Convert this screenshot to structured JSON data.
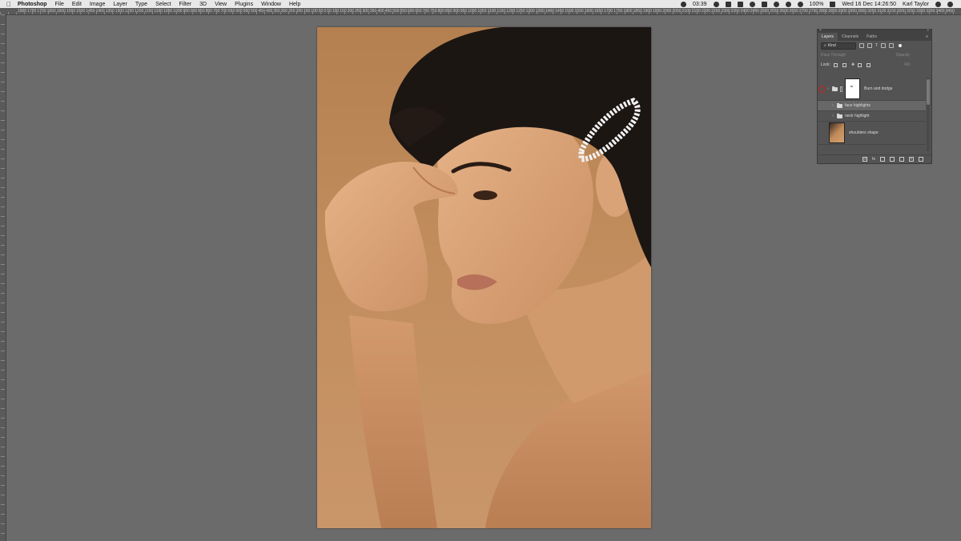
{
  "menubar": {
    "app_name": "Photoshop",
    "menus": [
      "File",
      "Edit",
      "Image",
      "Layer",
      "Type",
      "Select",
      "Filter",
      "3D",
      "View",
      "Plugins",
      "Window",
      "Help"
    ],
    "time_remaining": "03:39",
    "battery": "100%",
    "datetime": "Wed 16 Dec  14:26:50",
    "user": "Karl Taylor"
  },
  "ruler": {
    "ticks": [
      "1900",
      "1750",
      "1700",
      "1650",
      "1600",
      "1550",
      "1500",
      "1450",
      "1400",
      "1350",
      "1300",
      "1250",
      "1200",
      "1150",
      "1100",
      "1050",
      "1000",
      "950",
      "900",
      "850",
      "800",
      "750",
      "700",
      "650",
      "600",
      "550",
      "500",
      "450",
      "400",
      "350",
      "300",
      "250",
      "200",
      "150",
      "100",
      "50",
      "0",
      "50",
      "100",
      "150",
      "200",
      "250",
      "300",
      "350",
      "400",
      "450",
      "500",
      "550",
      "600",
      "650",
      "700",
      "750",
      "800",
      "850",
      "900",
      "950",
      "1000",
      "1050",
      "1100",
      "1150",
      "1200",
      "1250",
      "1300",
      "1350",
      "1400",
      "1450",
      "1500",
      "1550",
      "1600",
      "1650",
      "1700",
      "1750",
      "1800",
      "1850",
      "1900",
      "1950",
      "2000",
      "2050",
      "2100",
      "2150",
      "2200",
      "2250",
      "2300",
      "2350",
      "2400",
      "2450",
      "2500",
      "2550",
      "2600",
      "2650",
      "2700",
      "2750",
      "2800",
      "2850",
      "2900",
      "2950",
      "3000",
      "3050",
      "3100",
      "3150",
      "3200",
      "3250",
      "3300",
      "3350",
      "3400",
      "3450"
    ]
  },
  "colors": {
    "workspace": "#6b6b6b",
    "panel": "#535353",
    "backdrop": "#c18d5d",
    "skin": "#d9a57a",
    "hair": "#1c1613",
    "eye_highlight": "#d21f1f"
  },
  "layers_panel": {
    "tabs": [
      "Layers",
      "Channels",
      "Paths"
    ],
    "active_tab": "Layers",
    "filter_label": "Kind",
    "blend_mode": "Pass Through",
    "opacity_label": "Opacity:",
    "lock_label": "Lock:",
    "fill_label": "Fill:",
    "layers": [
      {
        "name": "Burn and dodge",
        "type": "group-with-mask",
        "selected": false
      },
      {
        "name": "face highlights",
        "type": "group",
        "selected": true
      },
      {
        "name": "neck highlight",
        "type": "group",
        "selected": false
      },
      {
        "name": "shoulders shape",
        "type": "pixel",
        "selected": false
      }
    ],
    "bottom_icons": [
      "link-icon",
      "fx-icon",
      "mask-icon",
      "adjustment-icon",
      "folder-icon",
      "new-layer-icon",
      "trash-icon"
    ],
    "bottom_fx": "fx"
  }
}
